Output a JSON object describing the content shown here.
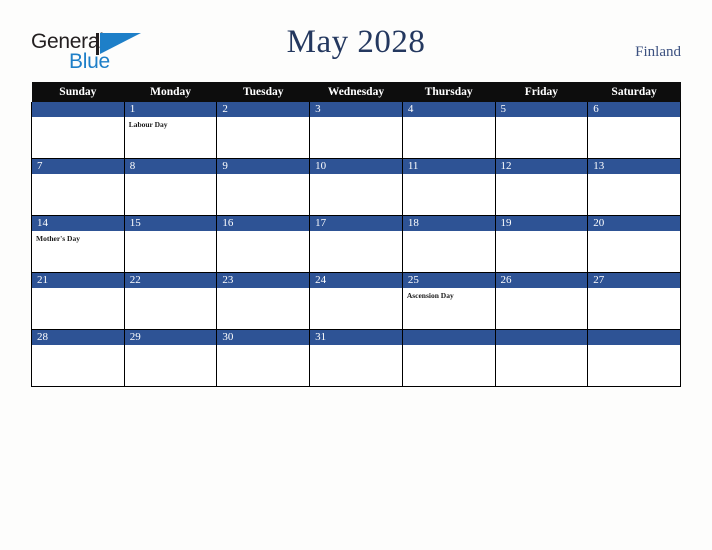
{
  "brand": {
    "name_part1": "General",
    "name_part2": "Blue",
    "logo_icon": "flag-triangle-icon"
  },
  "header": {
    "title": "May 2028",
    "country": "Finland"
  },
  "colors": {
    "header_row_bg": "#0d0d0d",
    "day_number_bg": "#2e5395",
    "title_text": "#24385f",
    "country_text": "#3c5180",
    "brand_blue": "#1e7fc8",
    "page_bg": "#fdfdfc"
  },
  "calendar": {
    "month": "May",
    "year": "2028",
    "weekday_headers": [
      "Sunday",
      "Monday",
      "Tuesday",
      "Wednesday",
      "Thursday",
      "Friday",
      "Saturday"
    ],
    "weeks": [
      [
        {
          "day": "",
          "events": []
        },
        {
          "day": "1",
          "events": [
            "Labour Day"
          ]
        },
        {
          "day": "2",
          "events": []
        },
        {
          "day": "3",
          "events": []
        },
        {
          "day": "4",
          "events": []
        },
        {
          "day": "5",
          "events": []
        },
        {
          "day": "6",
          "events": []
        }
      ],
      [
        {
          "day": "7",
          "events": []
        },
        {
          "day": "8",
          "events": []
        },
        {
          "day": "9",
          "events": []
        },
        {
          "day": "10",
          "events": []
        },
        {
          "day": "11",
          "events": []
        },
        {
          "day": "12",
          "events": []
        },
        {
          "day": "13",
          "events": []
        }
      ],
      [
        {
          "day": "14",
          "events": [
            "Mother's Day"
          ]
        },
        {
          "day": "15",
          "events": []
        },
        {
          "day": "16",
          "events": []
        },
        {
          "day": "17",
          "events": []
        },
        {
          "day": "18",
          "events": []
        },
        {
          "day": "19",
          "events": []
        },
        {
          "day": "20",
          "events": []
        }
      ],
      [
        {
          "day": "21",
          "events": []
        },
        {
          "day": "22",
          "events": []
        },
        {
          "day": "23",
          "events": []
        },
        {
          "day": "24",
          "events": []
        },
        {
          "day": "25",
          "events": [
            "Ascension Day"
          ]
        },
        {
          "day": "26",
          "events": []
        },
        {
          "day": "27",
          "events": []
        }
      ],
      [
        {
          "day": "28",
          "events": []
        },
        {
          "day": "29",
          "events": []
        },
        {
          "day": "30",
          "events": []
        },
        {
          "day": "31",
          "events": []
        },
        {
          "day": "",
          "events": []
        },
        {
          "day": "",
          "events": []
        },
        {
          "day": "",
          "events": []
        }
      ]
    ]
  }
}
